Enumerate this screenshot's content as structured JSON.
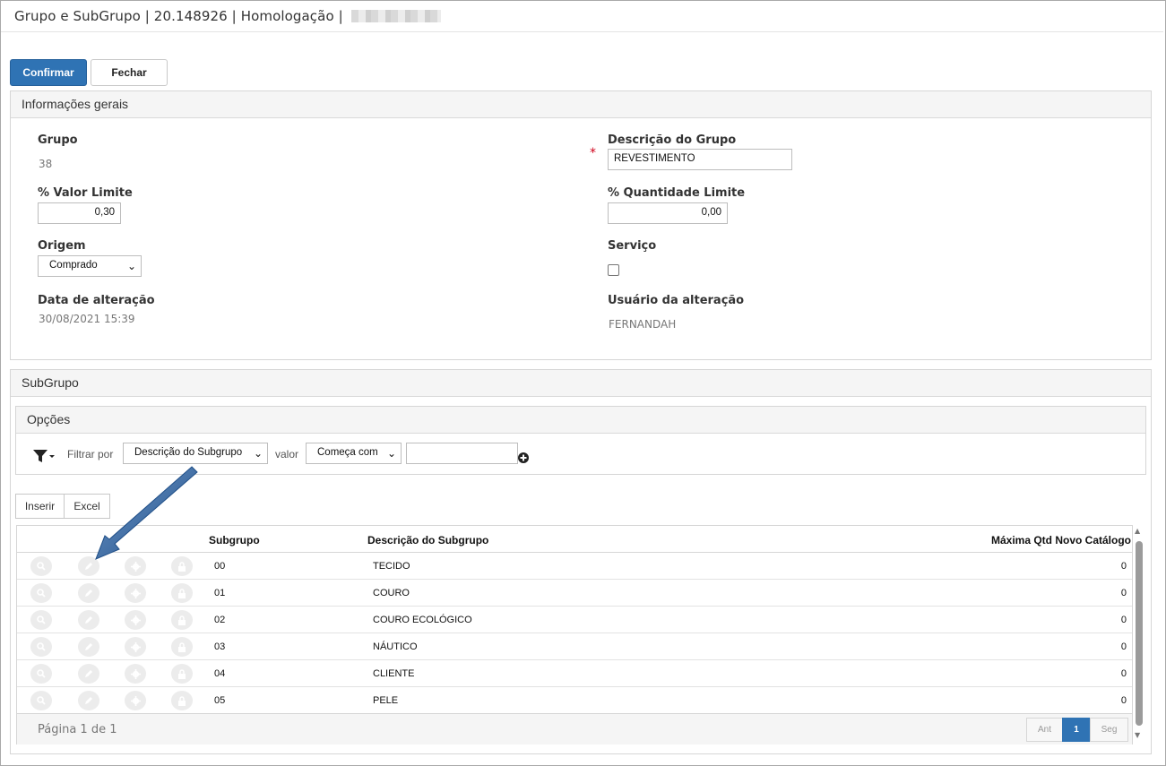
{
  "window": {
    "title": "Grupo e SubGrupo | 20.148926 | Homologação |"
  },
  "toolbar": {
    "confirm_label": "Confirmar",
    "close_label": "Fechar"
  },
  "general_panel": {
    "title": "Informações gerais",
    "grupo_label": "Grupo",
    "grupo_value": "38",
    "descricao_label": "Descrição do Grupo",
    "descricao_value": "REVESTIMENTO",
    "valor_limite_label": "% Valor Limite",
    "valor_limite_value": "0,30",
    "qtd_limite_label": "% Quantidade Limite",
    "qtd_limite_value": "0,00",
    "origem_label": "Origem",
    "origem_value": "Comprado",
    "servico_label": "Serviço",
    "servico_checked": false,
    "data_alteracao_label": "Data de alteração",
    "data_alteracao_value": "30/08/2021 15:39",
    "usuario_alteracao_label": "Usuário da alteração",
    "usuario_alteracao_value": "FERNANDAH",
    "required_mark": "*"
  },
  "subgrupo_panel": {
    "title": "SubGrupo",
    "options_title": "Opções",
    "filter_label": "Filtrar por",
    "filter_field_value": "Descrição do Subgrupo",
    "value_label": "valor",
    "operator_value": "Começa com",
    "filter_text_value": "",
    "insert_label": "Inserir",
    "excel_label": "Excel"
  },
  "grid": {
    "headers": {
      "subgrupo": "Subgrupo",
      "descricao": "Descrição do Subgrupo",
      "max_qtd": "Máxima Qtd Novo Catálogo"
    },
    "rows": [
      {
        "subgrupo": "00",
        "descricao": "TECIDO",
        "max_qtd": "0"
      },
      {
        "subgrupo": "01",
        "descricao": "COURO",
        "max_qtd": "0"
      },
      {
        "subgrupo": "02",
        "descricao": "COURO ECOLÓGICO",
        "max_qtd": "0"
      },
      {
        "subgrupo": "03",
        "descricao": "NÁUTICO",
        "max_qtd": "0"
      },
      {
        "subgrupo": "04",
        "descricao": "CLIENTE",
        "max_qtd": "0"
      },
      {
        "subgrupo": "05",
        "descricao": "PELE",
        "max_qtd": "0"
      }
    ],
    "footer": {
      "page_info": "Página 1 de 1",
      "prev_label": "Ant",
      "current_page": "1",
      "next_label": "Seg"
    }
  },
  "colors": {
    "primary": "#2f73b4",
    "annotation_arrow": "#1f4e87",
    "required": "#d0021b"
  },
  "icons": [
    "filter-icon",
    "plus-circle-icon",
    "search-icon",
    "pencil-icon",
    "gear-icon",
    "lock-icon",
    "annotation-arrow"
  ]
}
